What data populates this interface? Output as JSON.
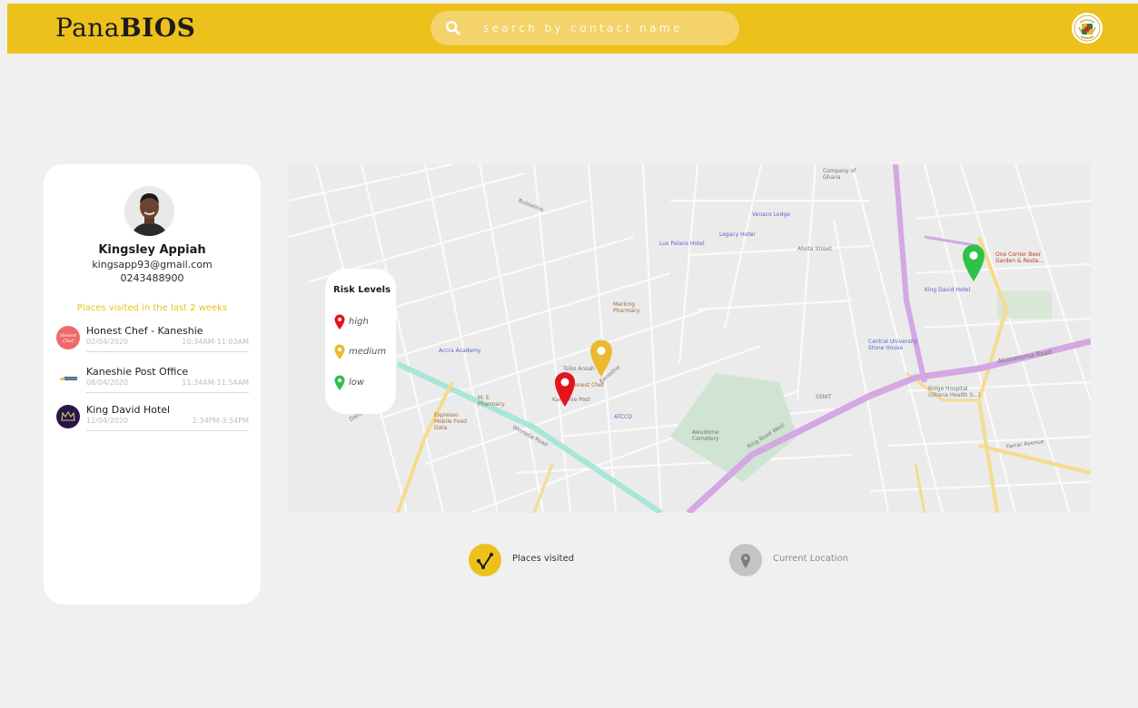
{
  "header": {
    "logo_part1": "Pana",
    "logo_part2": "BIOS",
    "search_placeholder": "search by contact name",
    "crest_icon": "coat-of-arms-icon",
    "brand_color": "#ecc11b"
  },
  "profile": {
    "name": "Kingsley Appiah",
    "email": "kingsapp93@gmail.com",
    "phone": "0243488900",
    "visits_title": "Places visited in the last 2 weeks",
    "places": [
      {
        "name": "Honest Chef - Kaneshie",
        "date": "02/04/2020",
        "time": "10:34AM-11:03AM",
        "logo": "honest-chef-logo"
      },
      {
        "name": "Kaneshie Post Office",
        "date": "08/04/2020",
        "time": "11:34AM-11:54AM",
        "logo": "ghana-post-logo"
      },
      {
        "name": "King David Hotel",
        "date": "12/04/2020",
        "time": "2:34PM-3:54PM",
        "logo": "king-david-logo"
      }
    ]
  },
  "map": {
    "risk_title": "Risk Levels",
    "risk_levels": [
      {
        "label": "high",
        "color": "#e4141a"
      },
      {
        "label": "medium",
        "color": "#eab92f"
      },
      {
        "label": "low",
        "color": "#2fc249"
      }
    ],
    "labels": {
      "company_ghana": "Company of Ghana",
      "venaco_lodge": "Venaco Lodge",
      "legacy_hotel": "Legacy Hotel",
      "lux_palace": "Lux Palace Hotel",
      "abota_street": "Abota Street",
      "one_corner": "One Corner Beer Garden & Resta...",
      "king_david_hotel": "King David Hotel",
      "marking_pharmacy": "Marking Pharmacy",
      "accra_academy": "Accra Academy",
      "central_university": "Central University Stone House",
      "akasanoma_road": "Akasanoma Road",
      "atccd": "ATCCD",
      "me_pharmacy": "M. E. Pharmacy",
      "espresso": "Espresso Mobile Food Data",
      "awudome_cemetery": "Awudome Cemetery",
      "ring_road": "Ring Road West",
      "winneba_road": "Winneba Road",
      "honest_chef": "Honest Chef",
      "kaneshie_post": "Kaneshie Post",
      "tsiko_ansah": "Tsiko Ansah",
      "dansoman_road": "Dansoman Road",
      "ssnit": "SSNIT",
      "bubiashie": "Bubiashie",
      "farrar_avenue": "Farrar Avenue",
      "ridge_hospital": "Ridge Hospital (Ghana Health S...)",
      "kaneshie": "Kaneshie"
    }
  },
  "bottom": {
    "places_visited": "Places visited",
    "current_location": "Current Location"
  }
}
